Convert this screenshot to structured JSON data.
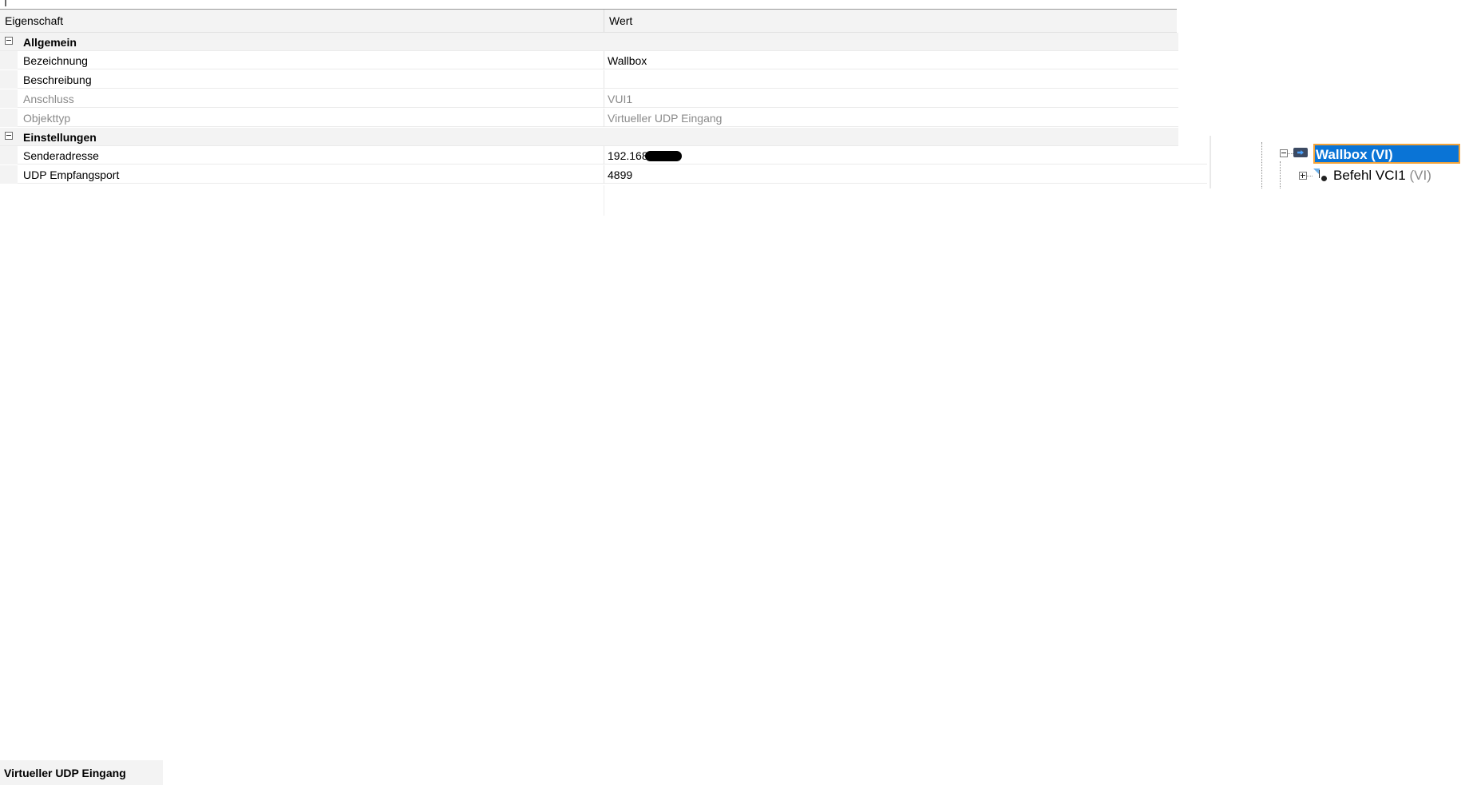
{
  "grid": {
    "header": {
      "property_col": "Eigenschaft",
      "value_col": "Wert"
    },
    "categories": [
      {
        "name": "Allgemein",
        "rows": [
          {
            "label": "Bezeichnung",
            "value": "Wallbox"
          },
          {
            "label": "Beschreibung",
            "value": ""
          },
          {
            "label": "Anschluss",
            "value": "VUI1"
          },
          {
            "label": "Objekttyp",
            "value": "Virtueller UDP Eingang"
          }
        ]
      },
      {
        "name": "Einstellungen",
        "rows": [
          {
            "label": "Senderadresse",
            "value": "192.168"
          },
          {
            "label": "UDP Empfangsport",
            "value": "4899"
          }
        ]
      }
    ]
  },
  "tree": {
    "selected_label": "Wallbox (VI)",
    "child_label": "Befehl VCI1",
    "child_suffix": "(VI)"
  },
  "statusbar": {
    "text": "Virtueller UDP Eingang"
  },
  "colors": {
    "selection": "#0a74d6",
    "selection_border": "#f2a33a",
    "category_bg": "#f3f3f3",
    "readonly_text": "#8a8a8a"
  }
}
